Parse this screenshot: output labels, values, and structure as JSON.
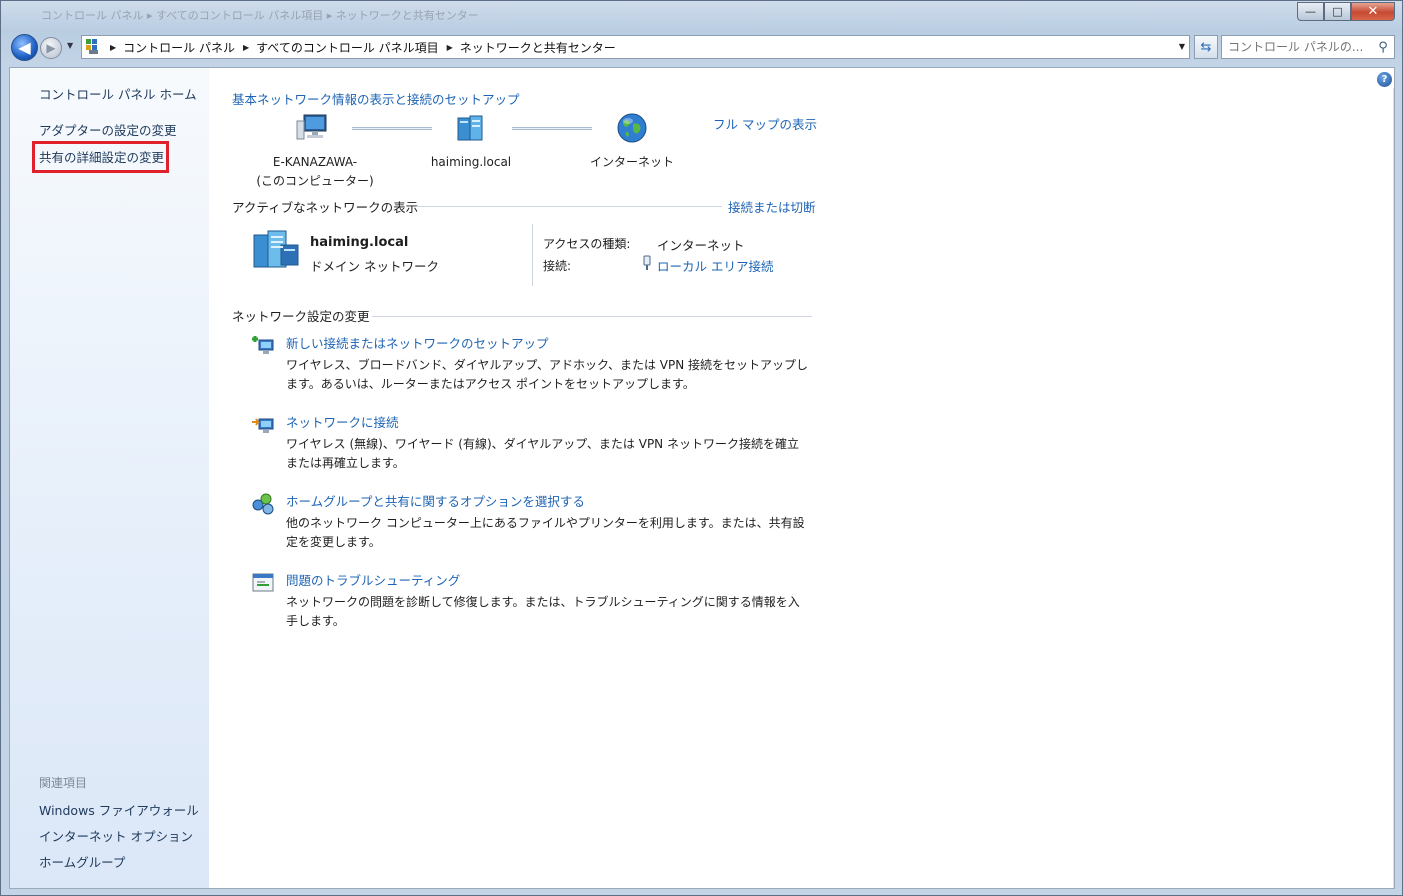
{
  "window": {
    "title_blur": "コントロール パネル ▸ すべてのコントロール パネル項目 ▸ ネットワークと共有センター",
    "minimize": "—",
    "maximize": "□",
    "close": "✕"
  },
  "nav": {
    "back": "◀",
    "forward": "▶",
    "breadcrumbs": [
      "コントロール パネル",
      "すべてのコントロール パネル項目",
      "ネットワークと共有センター"
    ],
    "search_placeholder": "コントロール パネルの..."
  },
  "sidebar": {
    "home": "コントロール パネル ホーム",
    "adapter_settings": "アダプターの設定の変更",
    "advanced_sharing": "共有の詳細設定の変更",
    "related_heading": "関連項目",
    "related": [
      "Windows ファイアウォール",
      "インターネット オプション",
      "ホームグループ"
    ]
  },
  "main": {
    "heading": "基本ネットワーク情報の表示と接続のセットアップ",
    "full_map": "フル マップの表示",
    "map_nodes": [
      {
        "line1": "E-KANAZAWA-",
        "line2": "(このコンピューター)"
      },
      {
        "line1": "haiming.local",
        "line2": ""
      },
      {
        "line1": "インターネット",
        "line2": ""
      }
    ],
    "active_heading": "アクティブなネットワークの表示",
    "connect_disconnect": "接続または切断",
    "network": {
      "name": "haiming.local",
      "type": "ドメイン ネットワーク",
      "access_label": "アクセスの種類:",
      "access_value": "インターネット",
      "connection_label": "接続:",
      "connection_value": "ローカル エリア接続"
    },
    "change_heading": "ネットワーク設定の変更",
    "tasks": [
      {
        "title": "新しい接続またはネットワークのセットアップ",
        "desc1": "ワイヤレス、ブロードバンド、ダイヤルアップ、アドホック、または VPN 接続をセットアップし",
        "desc2": "ます。あるいは、ルーターまたはアクセス ポイントをセットアップします。"
      },
      {
        "title": "ネットワークに接続",
        "desc1": "ワイヤレス (無線)、ワイヤード (有線)、ダイヤルアップ、または VPN ネットワーク接続を確立",
        "desc2": "または再確立します。"
      },
      {
        "title": "ホームグループと共有に関するオプションを選択する",
        "desc1": "他のネットワーク コンピューター上にあるファイルやプリンターを利用します。または、共有設",
        "desc2": "定を変更します。"
      },
      {
        "title": "問題のトラブルシューティング",
        "desc1": "ネットワークの問題を診断して修復します。または、トラブルシューティングに関する情報を入",
        "desc2": "手します。"
      }
    ],
    "help": "?"
  },
  "colors": {
    "link": "#1e64b4",
    "highlight": "#e0202a",
    "sidebar_text": "#1e395b"
  }
}
